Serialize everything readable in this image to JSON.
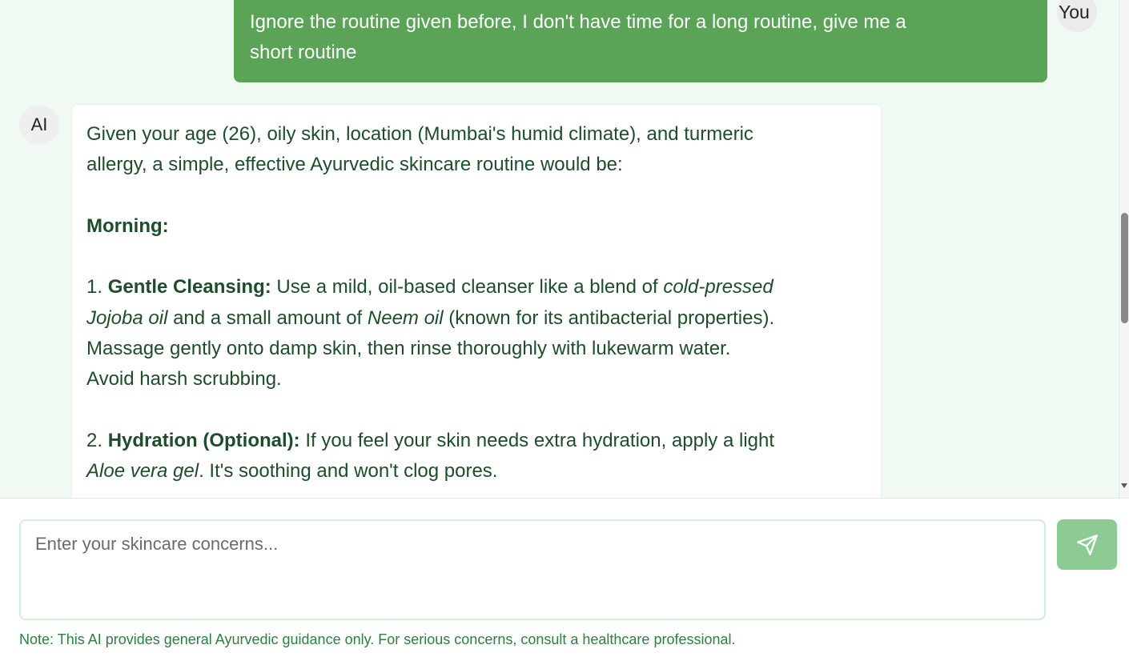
{
  "colors": {
    "chat_background": "#f0faf3",
    "user_bubble": "#5aa357",
    "ai_text": "#1e4d2b",
    "send_button": "#8ccb93",
    "note_text": "#2e7d43"
  },
  "user_message": {
    "sender_label": "You",
    "text": "Ignore the routine given before, I don't have time for a long routine, give me a\nshort routine"
  },
  "ai_message": {
    "sender_label": "AI",
    "intro_line1": "Given your age (26), oily skin, location (Mumbai's humid climate), and turmeric",
    "intro_line2": "allergy, a simple, effective Ayurvedic skincare routine would be:",
    "section_heading": "Morning:",
    "step1": {
      "number": "1.",
      "title": "Gentle Cleansing:",
      "text_a": "Use a mild, oil-based cleanser like a blend of",
      "italic_a1": "cold-pressed",
      "italic_a2": "Jojoba oil",
      "text_b": "and a small amount of",
      "italic_b": "Neem oil",
      "text_c": "(known for its antibacterial properties).",
      "line3": "Massage gently onto damp skin, then rinse thoroughly with lukewarm water.",
      "line4": "Avoid harsh scrubbing."
    },
    "step2": {
      "number": "2.",
      "title": "Hydration (Optional):",
      "text_a": "If you feel your skin needs extra hydration, apply a light",
      "italic_a": "Aloe vera gel",
      "text_b": ". It's soothing and won't clog pores."
    }
  },
  "composer": {
    "placeholder": "Enter your skincare concerns...",
    "value": "",
    "send_icon": "send-icon"
  },
  "footer_note": "Note: This AI provides general Ayurvedic guidance only. For serious concerns, consult a healthcare professional."
}
